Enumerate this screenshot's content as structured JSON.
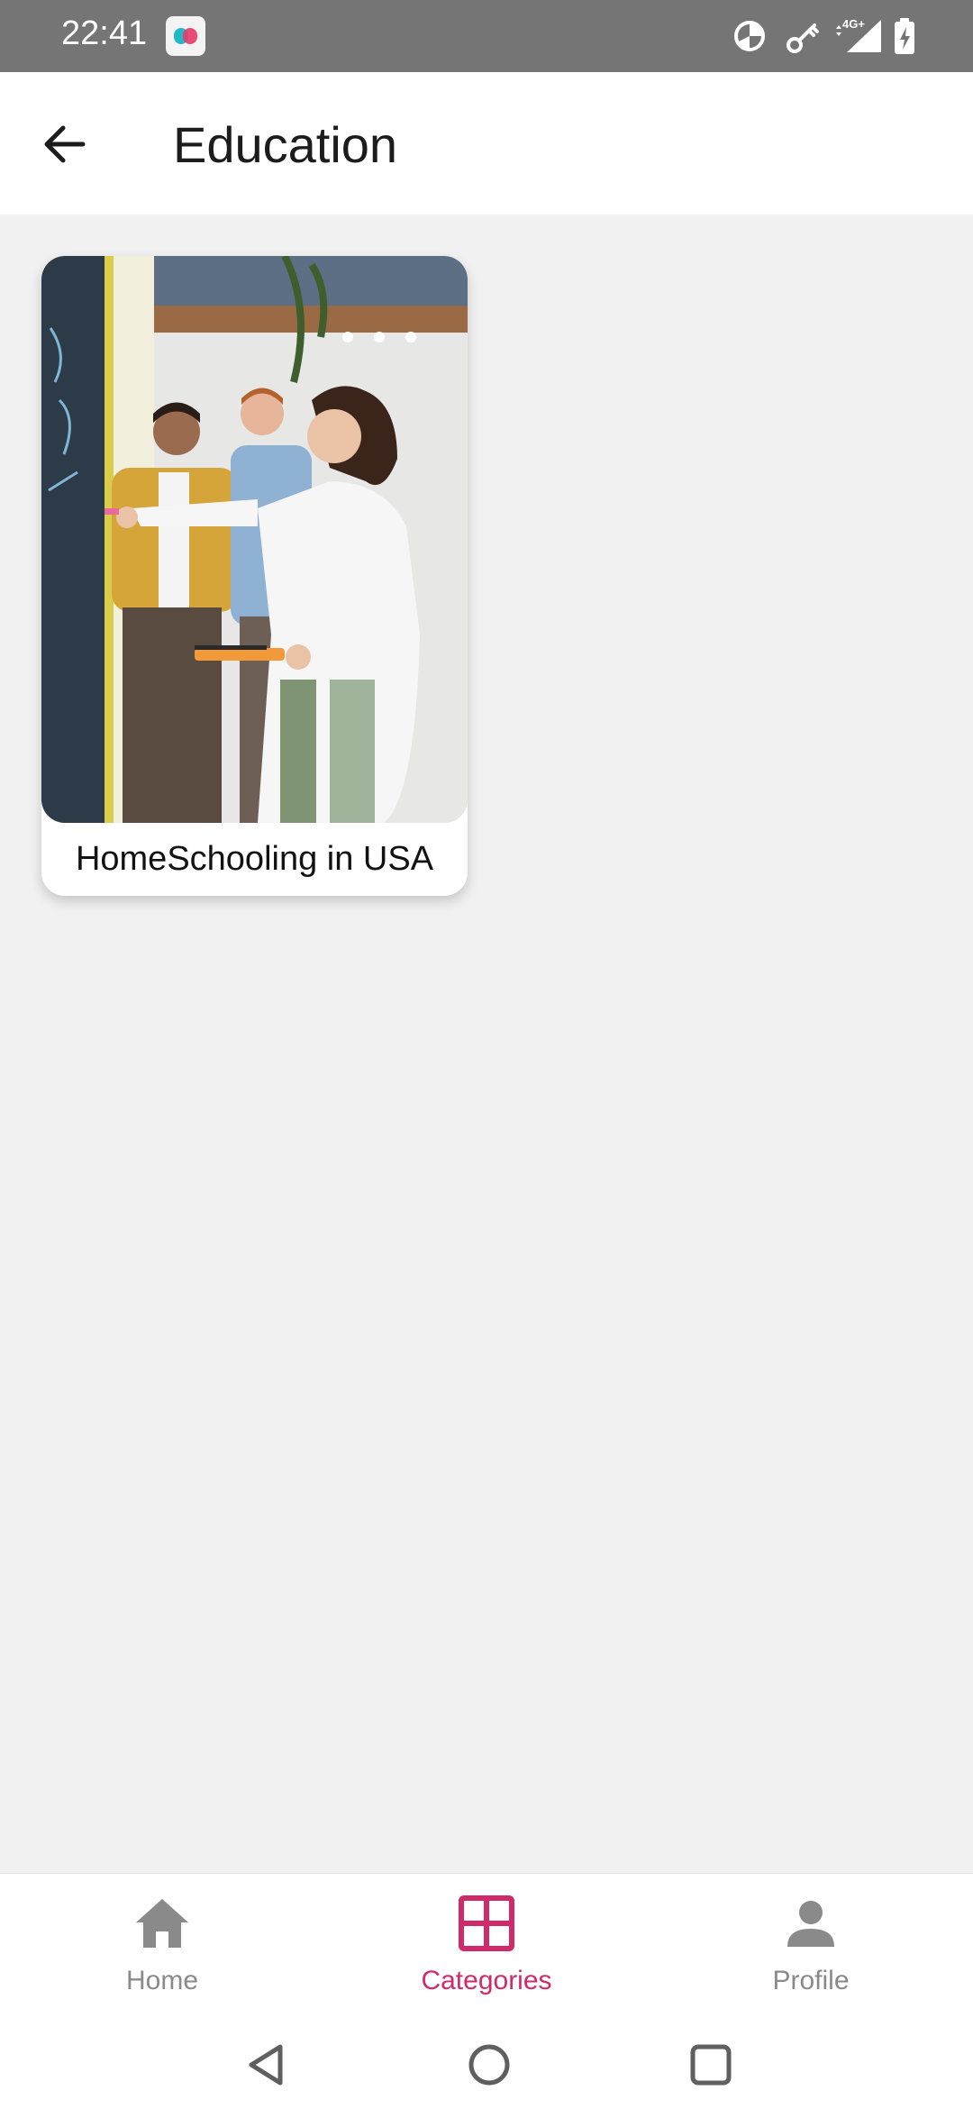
{
  "status_bar": {
    "time": "22:41",
    "network_label": "4G+",
    "icons": [
      "app-notification-icon",
      "data-saver-icon",
      "vpn-key-icon",
      "cellular-signal-icon",
      "battery-charging-icon"
    ]
  },
  "app_bar": {
    "title": "Education",
    "back_icon": "arrow-left-icon"
  },
  "cards": [
    {
      "title": "HomeSchooling in USA",
      "image": "classroom-photo"
    }
  ],
  "bottom_nav": {
    "items": [
      {
        "label": "Home",
        "icon": "home-icon",
        "active": false
      },
      {
        "label": "Categories",
        "icon": "grid-icon",
        "active": true
      },
      {
        "label": "Profile",
        "icon": "person-icon",
        "active": false
      }
    ]
  },
  "colors": {
    "accent": "#d02a6a",
    "inactive": "#8a8a8a",
    "status_bar": "#757575",
    "background": "#f1f1f1"
  },
  "system_nav": [
    "back-triangle-icon",
    "home-circle-icon",
    "recents-square-icon"
  ]
}
